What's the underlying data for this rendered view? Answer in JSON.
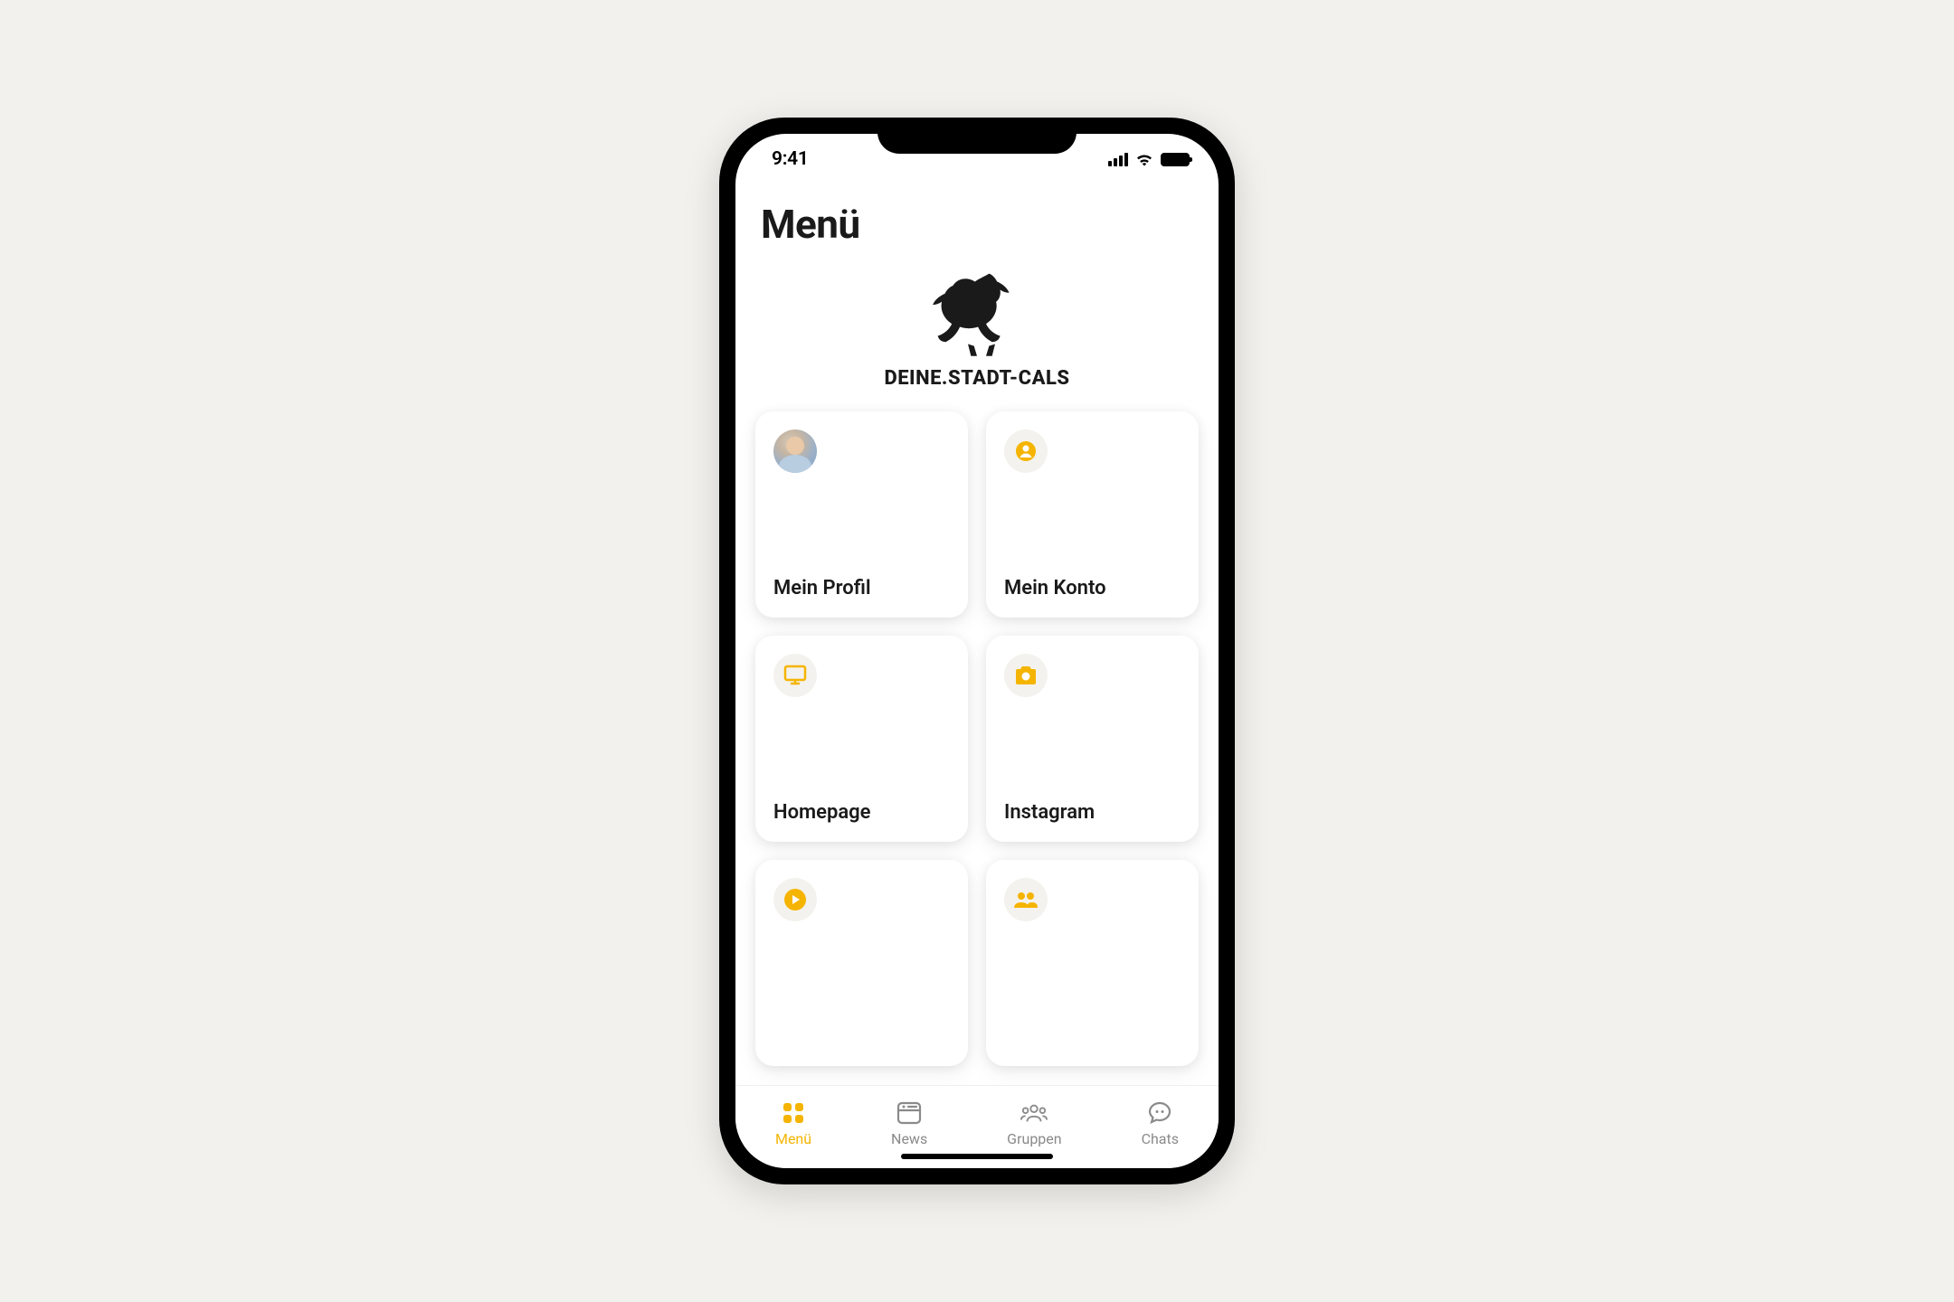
{
  "status_bar": {
    "time": "9:41"
  },
  "header": {
    "title": "Menü"
  },
  "brand": {
    "name": "DEINE.STADT-CALS"
  },
  "cards": [
    {
      "label": "Mein Profil",
      "icon": "avatar"
    },
    {
      "label": "Mein Konto",
      "icon": "account"
    },
    {
      "label": "Homepage",
      "icon": "monitor"
    },
    {
      "label": "Instagram",
      "icon": "camera"
    },
    {
      "label": "",
      "icon": "play"
    },
    {
      "label": "",
      "icon": "people"
    }
  ],
  "tabs": [
    {
      "label": "Menü",
      "active": true
    },
    {
      "label": "News",
      "active": false
    },
    {
      "label": "Gruppen",
      "active": false
    },
    {
      "label": "Chats",
      "active": false
    }
  ],
  "colors": {
    "accent": "#f5b400"
  }
}
